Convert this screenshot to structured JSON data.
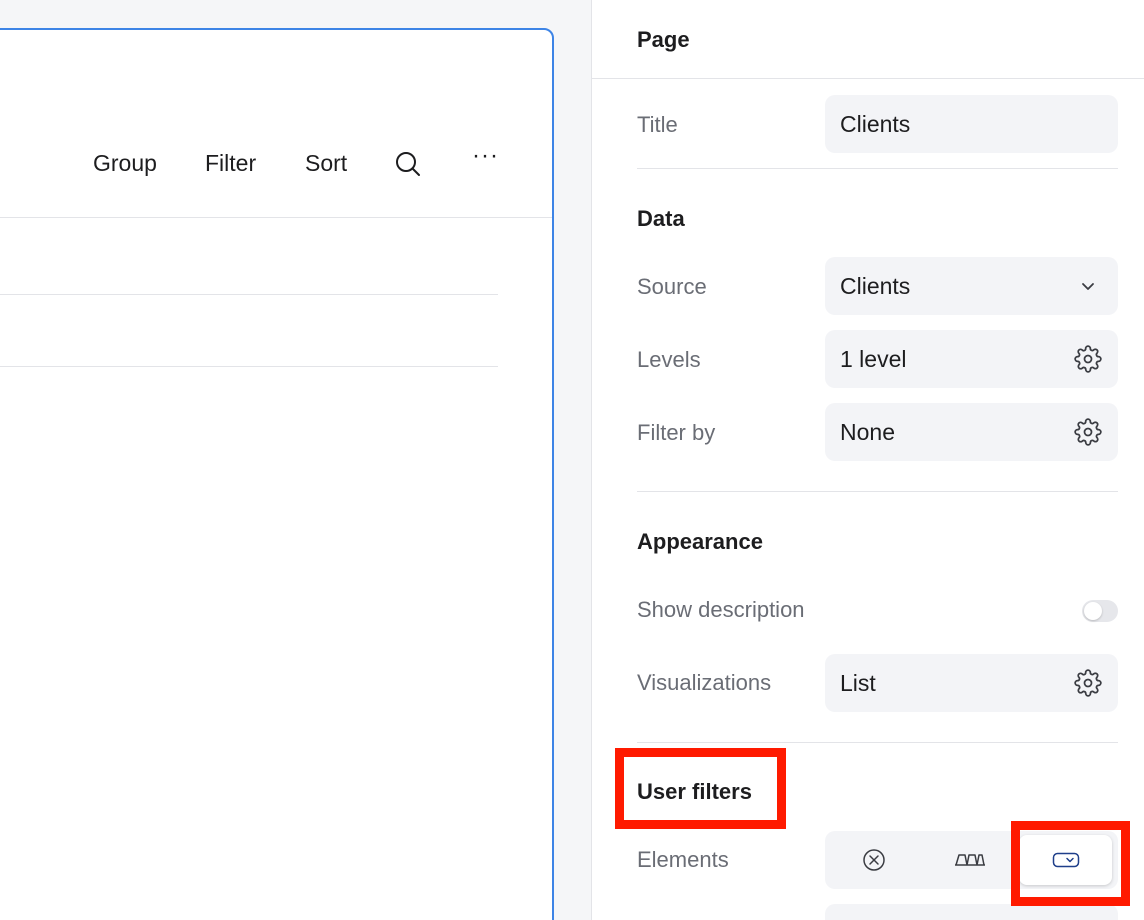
{
  "canvas": {
    "toolbar": {
      "group_label": "Group",
      "filter_label": "Filter",
      "sort_label": "Sort",
      "search_icon": "search-icon",
      "more_label": "···"
    }
  },
  "panel": {
    "page_section": {
      "heading": "Page"
    },
    "title_row": {
      "label": "Title",
      "value": "Clients"
    },
    "data_section": {
      "heading": "Data"
    },
    "source_row": {
      "label": "Source",
      "value": "Clients",
      "icon": "chevron-down-icon"
    },
    "levels_row": {
      "label": "Levels",
      "value": "1 level",
      "icon": "gear-icon"
    },
    "filter_row": {
      "label": "Filter by",
      "value": "None",
      "icon": "gear-icon"
    },
    "appearance_section": {
      "heading": "Appearance"
    },
    "description_row": {
      "label": "Show description",
      "toggle_on": false
    },
    "visualizations_row": {
      "label": "Visualizations",
      "value": "List",
      "icon": "gear-icon"
    },
    "user_filters_section": {
      "heading": "User filters"
    },
    "elements_row": {
      "label": "Elements",
      "options": [
        "none-icon",
        "tabs-icon",
        "dropdown-icon"
      ],
      "selected_index": 2
    }
  },
  "colors": {
    "accent": "#3d84e6",
    "annotation": "#ff1a00",
    "field_bg": "#f3f4f7"
  }
}
